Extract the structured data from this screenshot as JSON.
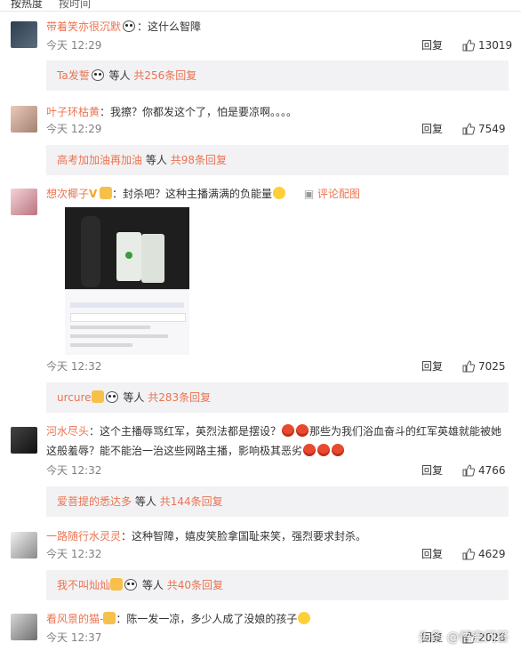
{
  "sort_tabs": [
    "按热度",
    "按时间"
  ],
  "reply_label": "回复",
  "comments": [
    {
      "user": "带着笑亦很沉默",
      "text": "：这什么智障",
      "time": "今天 12:29",
      "likes": "13019",
      "sub_user": "Ta发誓",
      "sub_mid": "等人",
      "sub_count": "共256条回复"
    },
    {
      "user": "叶子环枯黄",
      "text": "：我擦？你都发这个了，怕是要凉啊。。。。",
      "time": "今天 12:29",
      "likes": "7549",
      "sub_user": "高考加加油再加油",
      "sub_mid": "等人",
      "sub_count": "共98条回复"
    },
    {
      "user": "想次椰子",
      "text": "：封杀吧？这种主播满满的负能量",
      "time": "今天 12:32",
      "likes": "7025",
      "extra": "评论配图",
      "sub_user": "urcure",
      "sub_mid": "等人",
      "sub_count": "共283条回复"
    },
    {
      "user": "河水尽头",
      "text": "：这个主播辱骂红军，英烈法都是摆设？",
      "text2": "那些为我们浴血奋斗的红军英雄就能被她",
      "text3": "这般羞辱？能不能治一治这些网路主播，影响极其恶劣",
      "time": "今天 12:32",
      "likes": "4766",
      "sub_user": "爱菩提的悉达多",
      "sub_mid": "等人",
      "sub_count": "共144条回复"
    },
    {
      "user": "一路随行水灵灵",
      "text": "：这种智障，嬉皮笑脸拿国耻来笑，强烈要求封杀。",
      "time": "今天 12:32",
      "likes": "4629",
      "sub_user": "我不叫灿灿",
      "sub_mid": "等人",
      "sub_count": "共40条回复"
    },
    {
      "user": "看风景的猫-",
      "text": "：陈一发一凉，多少人成了没娘的孩子",
      "time": "今天 12:37",
      "likes": "2028"
    }
  ],
  "watermark": "头条 @悟空问答",
  "colors": {
    "username": "#eb7350",
    "subbox_bg": "#f2f2f5"
  }
}
